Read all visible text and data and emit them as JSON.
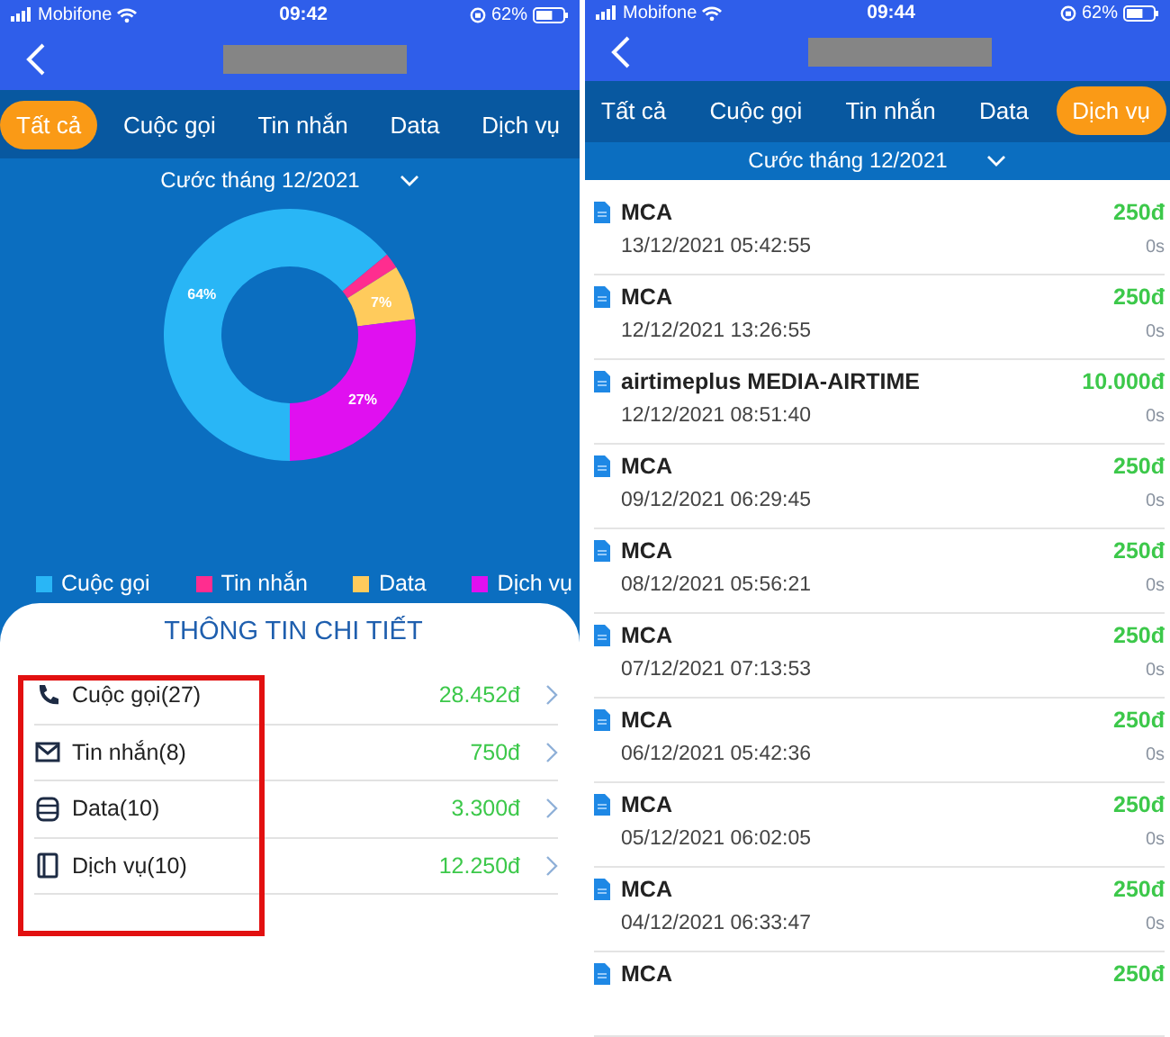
{
  "screens": [
    {
      "kind": "summary",
      "status_bar": {
        "carrier": "Mobifone",
        "time": "09:42",
        "battery": "62%"
      },
      "tabs": [
        {
          "label": "Tất cả",
          "selected": true
        },
        {
          "label": "Cuộc gọi",
          "selected": false
        },
        {
          "label": "Tin nhắn",
          "selected": false
        },
        {
          "label": "Data",
          "selected": false
        },
        {
          "label": "Dịch vụ",
          "selected": false
        }
      ],
      "period": "Cước tháng 12/2021",
      "chart_data": {
        "type": "donut",
        "values": [
          64,
          2,
          7,
          27
        ],
        "value_labels": [
          "64%",
          null,
          "7%",
          "27%"
        ]
      },
      "legend": [
        {
          "label": "Cuộc gọi",
          "color": "#29b6f6"
        },
        {
          "label": "Tin nhắn",
          "color": "#ff2d8f"
        },
        {
          "label": "Data",
          "color": "#ffcb5c"
        },
        {
          "label": "Dịch vụ",
          "color": "#e010f0"
        }
      ],
      "detail": {
        "title": "THÔNG TIN CHI TIẾT",
        "framed": true,
        "rows": [
          {
            "kind": "phone",
            "label": "Cuộc gọi(27)",
            "amount": "28.452đ"
          },
          {
            "kind": "mail",
            "label": "Tin nhắn(8)",
            "amount": "750đ"
          },
          {
            "kind": "database",
            "label": "Data(10)",
            "amount": "3.300đ"
          },
          {
            "kind": "book",
            "label": "Dịch vụ(10)",
            "amount": "12.250đ"
          }
        ]
      }
    },
    {
      "kind": "list",
      "status_bar": {
        "carrier": "Mobifone",
        "time": "09:44",
        "battery": "62%"
      },
      "tabs": [
        {
          "label": "Tất cả",
          "selected": false
        },
        {
          "label": "Cuộc gọi",
          "selected": false
        },
        {
          "label": "Tin nhắn",
          "selected": false
        },
        {
          "label": "Data",
          "selected": false
        },
        {
          "label": "Dịch vụ",
          "selected": true
        }
      ],
      "period": "Cước tháng 12/2021",
      "items": [
        {
          "title": "MCA",
          "time": "13/12/2021 05:42:55",
          "amount": "250đ",
          "duration": "0s"
        },
        {
          "title": "MCA",
          "time": "12/12/2021 13:26:55",
          "amount": "250đ",
          "duration": "0s"
        },
        {
          "title": "airtimeplus MEDIA-AIRTIME",
          "time": "12/12/2021 08:51:40",
          "amount": "10.000đ",
          "duration": "0s"
        },
        {
          "title": "MCA",
          "time": "09/12/2021 06:29:45",
          "amount": "250đ",
          "duration": "0s"
        },
        {
          "title": "MCA",
          "time": "08/12/2021 05:56:21",
          "amount": "250đ",
          "duration": "0s"
        },
        {
          "title": "MCA",
          "time": "07/12/2021 07:13:53",
          "amount": "250đ",
          "duration": "0s"
        },
        {
          "title": "MCA",
          "time": "06/12/2021 05:42:36",
          "amount": "250đ",
          "duration": "0s"
        },
        {
          "title": "MCA",
          "time": "05/12/2021 06:02:05",
          "amount": "250đ",
          "duration": "0s"
        },
        {
          "title": "MCA",
          "time": "04/12/2021 06:33:47",
          "amount": "250đ",
          "duration": "0s"
        },
        {
          "title": "MCA",
          "amount": "250đ"
        }
      ]
    }
  ]
}
